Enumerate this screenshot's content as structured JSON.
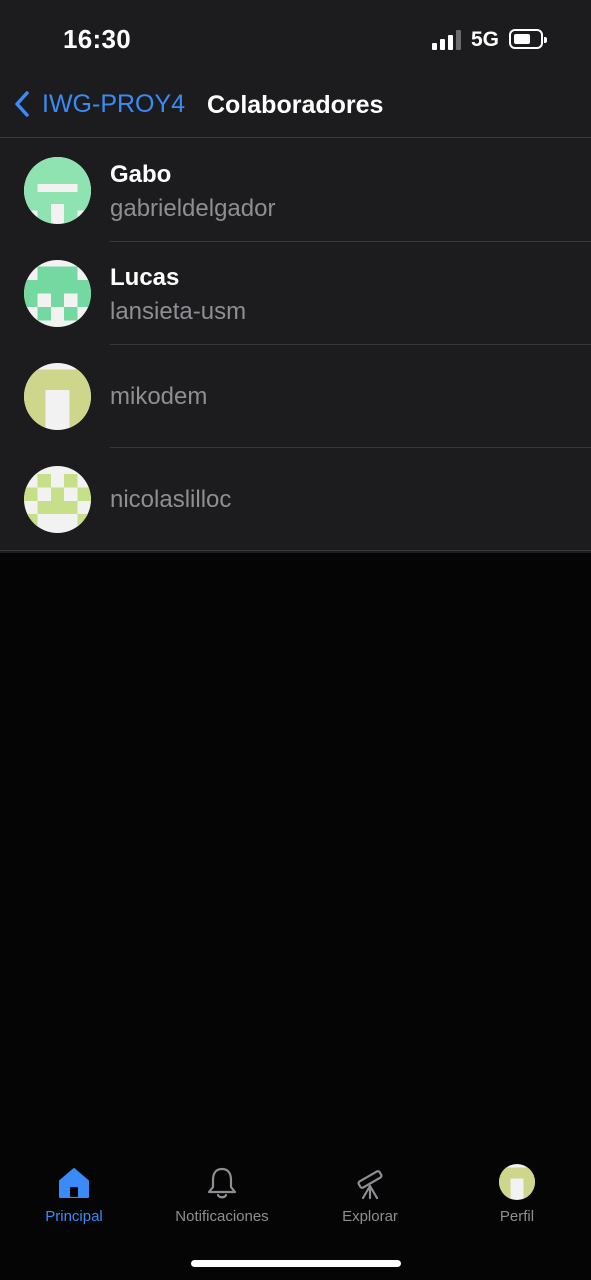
{
  "status_bar": {
    "time": "16:30",
    "network": "5G"
  },
  "nav": {
    "back_label": "IWG-PROY4",
    "title": "Colaboradores"
  },
  "collaborators": [
    {
      "name": "Gabo",
      "login": "gabrieldelgador",
      "avatar_color": "#8fe3b0"
    },
    {
      "name": "Lucas",
      "login": "lansieta-usm",
      "avatar_color": "#74d9a0"
    },
    {
      "name": "",
      "login": "mikodem",
      "avatar_color": "#cdd68a"
    },
    {
      "name": "",
      "login": "nicolaslilloc",
      "avatar_color": "#c6e08a"
    }
  ],
  "tabs": [
    {
      "label": "Principal",
      "icon": "home-icon",
      "active": true
    },
    {
      "label": "Notificaciones",
      "icon": "bell-icon",
      "active": false
    },
    {
      "label": "Explorar",
      "icon": "telescope-icon",
      "active": false
    },
    {
      "label": "Perfil",
      "icon": "profile-avatar",
      "active": false
    }
  ],
  "colors": {
    "accent": "#3a8bf7",
    "secondary_text": "#8e8e93",
    "panel": "#1c1c1e",
    "background": "#050505"
  }
}
